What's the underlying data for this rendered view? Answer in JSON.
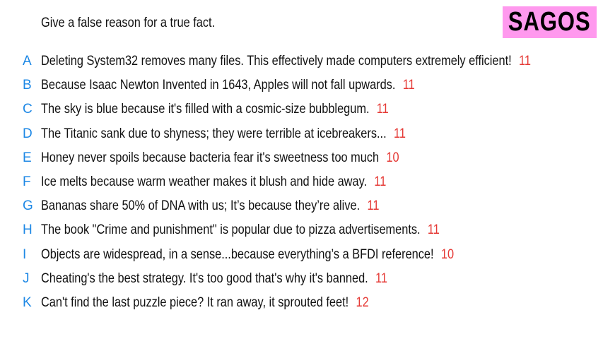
{
  "prompt": "Give a false reason for a true fact.",
  "badge": "SAGOS",
  "colors": {
    "badge_background": "#ff99ee",
    "letter": "#1e88e5",
    "count": "#e53935",
    "text": "#111111"
  },
  "entries": [
    {
      "letter": "A",
      "text": "Deleting System32 removes many files. This effectively made computers extremely efficient!",
      "count": "11"
    },
    {
      "letter": "B",
      "text": "Because Isaac Newton Invented in 1643, Apples will not fall upwards.",
      "count": "11"
    },
    {
      "letter": "C",
      "text": "The sky is blue because it's filled with a cosmic-size bubblegum.",
      "count": "11"
    },
    {
      "letter": "D",
      "text": "The Titanic sank due to shyness; they were terrible at icebreakers...",
      "count": "11"
    },
    {
      "letter": "E",
      "text": "Honey never spoils because bacteria fear it's sweetness too much",
      "count": "10"
    },
    {
      "letter": "F",
      "text": "Ice melts because warm weather makes it blush and hide away.",
      "count": "11"
    },
    {
      "letter": "G",
      "text": "Bananas share 50% of DNA with us; It’s because they’re alive.",
      "count": "11"
    },
    {
      "letter": "H",
      "text": "The book \"Crime and punishment\" is popular due to pizza advertisements.",
      "count": "11"
    },
    {
      "letter": "I",
      "text": "Objects are widespread, in a sense...because everything’s a BFDI reference!",
      "count": "10"
    },
    {
      "letter": "J",
      "text": "Cheating's the best strategy. It's too good that's why it's banned.",
      "count": "11"
    },
    {
      "letter": "K",
      "text": "Can't find the last puzzle piece? It ran away, it sprouted feet!",
      "count": "12"
    }
  ]
}
